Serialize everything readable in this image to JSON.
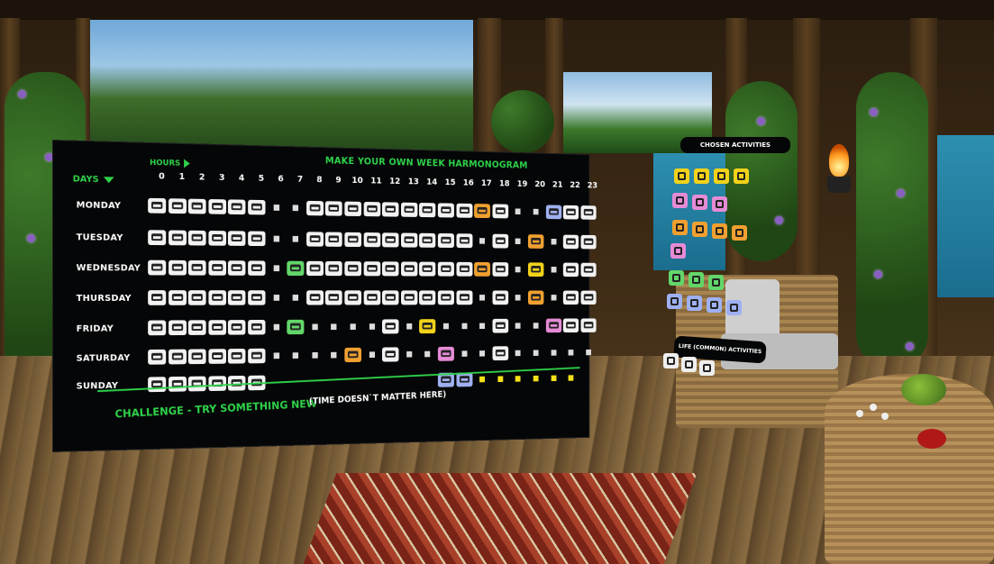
{
  "board": {
    "title": "MAKE YOUR OWN WEEK HARMONOGRAM",
    "hours_label": "HOURS",
    "days_label": "DAYS",
    "hours": [
      "0",
      "1",
      "2",
      "3",
      "4",
      "5",
      "6",
      "7",
      "8",
      "9",
      "10",
      "11",
      "12",
      "13",
      "14",
      "15",
      "16",
      "17",
      "18",
      "19",
      "20",
      "21",
      "22",
      "23"
    ],
    "days": [
      "MONDAY",
      "TUESDAY",
      "WEDNESDAY",
      "THURSDAY",
      "FRIDAY",
      "SATURDAY",
      "SUNDAY"
    ],
    "challenge_label": "CHALLENGE - TRY SOMETHING NEW",
    "challenge_note": "(TIME DOESN`T MATTER HERE)"
  },
  "side_panels": {
    "chosen_title": "CHOSEN ACTIVITIES",
    "life_title": "LIFE (COMMON) ACTIVITIES"
  },
  "icons": {
    "sleep": "bed-icon",
    "work": "desk-work-icon",
    "meal": "plate-icon"
  },
  "colors": {
    "board_text": "#2fd24a",
    "activity_orange": "#f0a030",
    "activity_green": "#63d66a",
    "activity_yellow": "#f2d21a",
    "activity_pink": "#e58bd6",
    "activity_blue": "#9fb0f2"
  }
}
